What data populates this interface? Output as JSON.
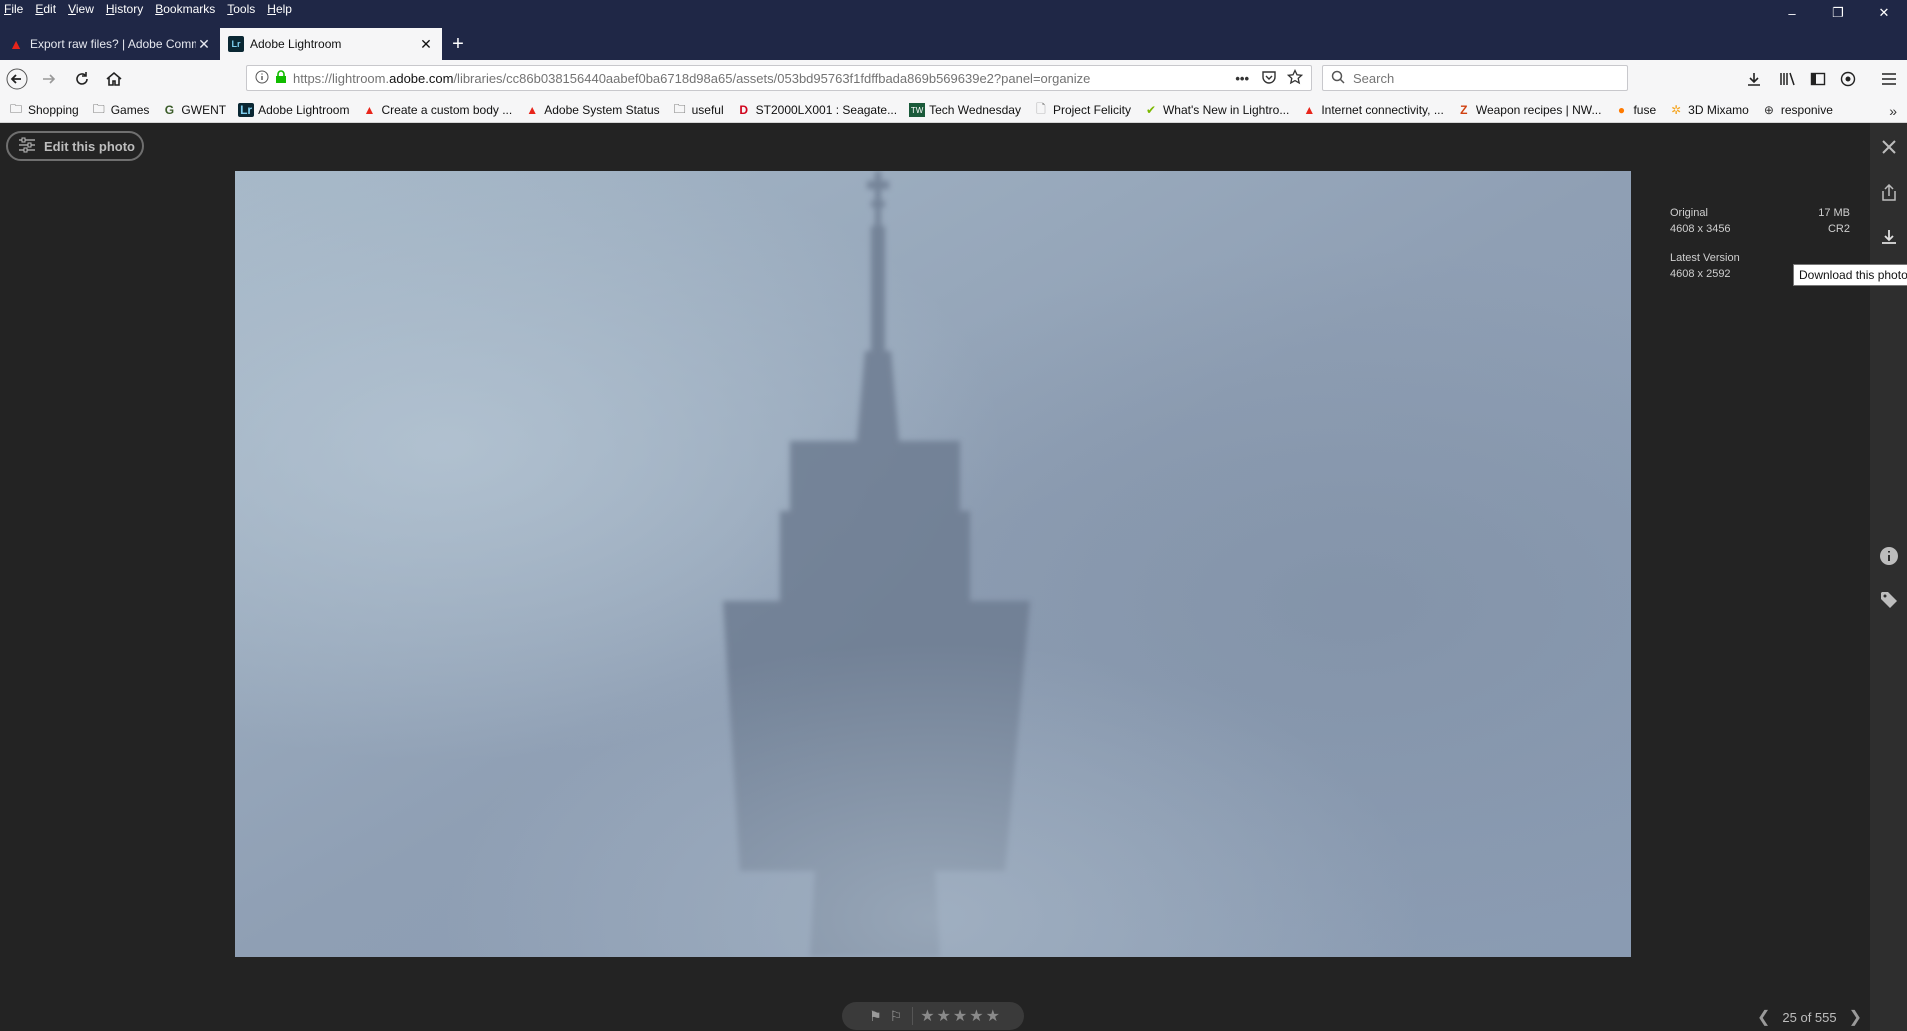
{
  "menubar": [
    {
      "u": "F",
      "rest": "ile"
    },
    {
      "u": "E",
      "rest": "dit"
    },
    {
      "u": "V",
      "rest": "iew"
    },
    {
      "u": "H",
      "rest": "istory"
    },
    {
      "u": "B",
      "rest": "ookmarks"
    },
    {
      "u": "T",
      "rest": "ools"
    },
    {
      "u": "H",
      "rest": "elp"
    }
  ],
  "window_controls": {
    "minimize": "–",
    "restore": "❐",
    "close": "✕"
  },
  "tabs": [
    {
      "title": "Export raw files? | Adobe Community",
      "favicon": "adobe-icon"
    },
    {
      "title": "Adobe Lightroom",
      "favicon": "lightroom-icon"
    }
  ],
  "toolbar": {
    "url_prefix": "https://lightroom.",
    "url_domain": "adobe.com",
    "url_suffix": "/libraries/cc86b038156440aabef0ba6718d98a65/assets/053bd95763f1fdffbada869b569639e2?panel=organize",
    "search_placeholder": "Search"
  },
  "bookmarks": [
    {
      "label": "Shopping",
      "icon": "folder-icon"
    },
    {
      "label": "Games",
      "icon": "folder-icon"
    },
    {
      "label": "GWENT",
      "icon": "gwent-icon"
    },
    {
      "label": "Adobe Lightroom",
      "icon": "lightroom-icon"
    },
    {
      "label": "Create a custom body ...",
      "icon": "adobe-icon"
    },
    {
      "label": "Adobe System Status",
      "icon": "adobe-icon"
    },
    {
      "label": "useful",
      "icon": "folder-icon"
    },
    {
      "label": "ST2000LX001 : Seagate...",
      "icon": "seagate-icon"
    },
    {
      "label": "Tech Wednesday",
      "icon": "tech-icon"
    },
    {
      "label": "Project Felicity",
      "icon": "page-icon"
    },
    {
      "label": "What's New in Lightro...",
      "icon": "check-icon"
    },
    {
      "label": "Internet connectivity, ...",
      "icon": "adobe-icon"
    },
    {
      "label": "Weapon recipes | NW...",
      "icon": "z-icon"
    },
    {
      "label": "fuse",
      "icon": "firefox-icon"
    },
    {
      "label": "3D Mixamo",
      "icon": "mixamo-icon"
    },
    {
      "label": "responive",
      "icon": "globe-icon"
    }
  ],
  "lightroom": {
    "edit_button": "Edit this photo",
    "info": {
      "original_label": "Original",
      "original_size": "17 MB",
      "original_dims": "4608 x 3456",
      "original_format": "CR2",
      "latest_label": "Latest Version",
      "latest_dims": "4608 x 2592"
    },
    "tooltip": "Download this photo",
    "pager": "25 of 555",
    "rating_stars": 5,
    "rating_value": 0
  }
}
